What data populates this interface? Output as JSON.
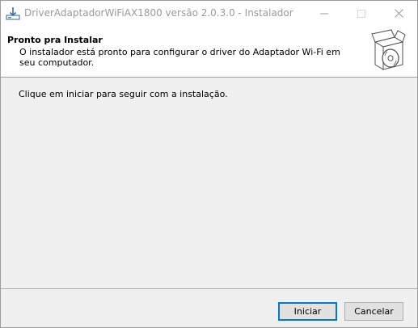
{
  "window": {
    "title": "DriverAdaptadorWiFiAX1800 versão 2.0.3.0 - Instalador",
    "icon": "installer-download-icon"
  },
  "header": {
    "title": "Pronto pra Instalar",
    "description": "O instalador está pronto para configurar o driver do Adaptador Wi-Fi em seu computador.",
    "icon": "software-box-disc-icon"
  },
  "content": {
    "instruction": "Clique em iniciar para seguir com a instalação."
  },
  "buttons": {
    "next": "Iniciar",
    "cancel": "Cancelar"
  },
  "colors": {
    "accent": "#0078d7",
    "title_inactive": "#9a9a9a",
    "background": "#f0f0f0"
  }
}
